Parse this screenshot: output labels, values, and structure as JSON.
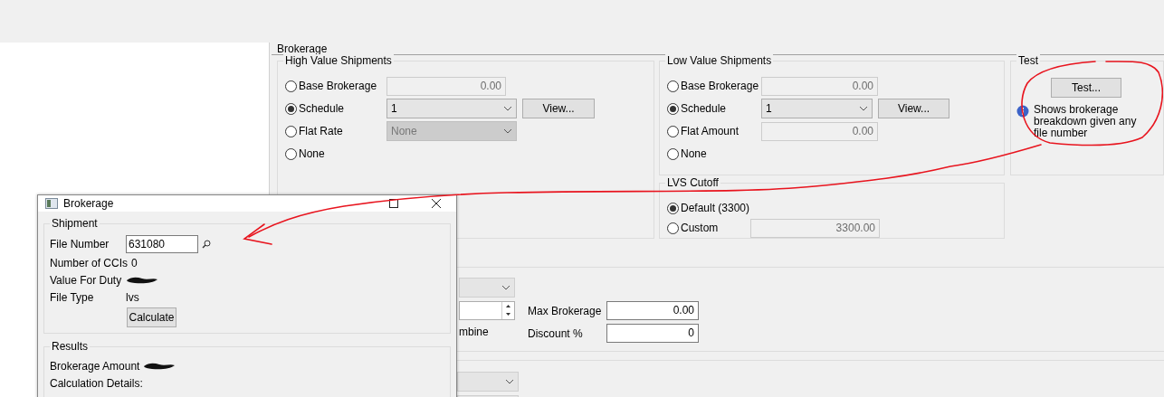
{
  "section_title": "Brokerage",
  "high_value": {
    "title": "High Value Shipments",
    "options": [
      {
        "label": "Base Brokerage",
        "selected": false,
        "kind": "input",
        "value": "0.00"
      },
      {
        "label": "Schedule",
        "selected": true,
        "kind": "select",
        "value": "1",
        "button": "View..."
      },
      {
        "label": "Flat Rate",
        "selected": false,
        "kind": "select_disabled",
        "value": "None"
      },
      {
        "label": "None",
        "selected": false,
        "kind": "none"
      }
    ]
  },
  "low_value": {
    "title": "Low Value Shipments",
    "options": [
      {
        "label": "Base Brokerage",
        "selected": false,
        "kind": "input",
        "value": "0.00"
      },
      {
        "label": "Schedule",
        "selected": true,
        "kind": "select",
        "value": "1",
        "button": "View..."
      },
      {
        "label": "Flat Amount",
        "selected": false,
        "kind": "input",
        "value": "0.00"
      },
      {
        "label": "None",
        "selected": false,
        "kind": "none"
      }
    ]
  },
  "test": {
    "title": "Test",
    "button": "Test...",
    "info": "Shows brokerage breakdown given any file number"
  },
  "lvs_cutoff": {
    "title": "LVS Cutoff",
    "options": [
      {
        "label": "Default (3300)",
        "selected": true,
        "kind": "none"
      },
      {
        "label": "Custom",
        "selected": false,
        "kind": "input",
        "value": "3300.00"
      }
    ]
  },
  "lower": {
    "partial_label": "mbine",
    "fields": [
      {
        "label": "Max Brokerage",
        "value": "0.00"
      },
      {
        "label": "Discount %",
        "value": "0"
      }
    ]
  },
  "dialog": {
    "title": "Brokerage",
    "shipment": {
      "title": "Shipment",
      "file_number_label": "File Number",
      "file_number": "631080",
      "rows": [
        {
          "label": "Number of CCIs",
          "value": "0",
          "redacted": false
        },
        {
          "label": "Value For Duty",
          "redacted": true
        },
        {
          "label": "File Type",
          "value": "lvs",
          "redacted": false
        }
      ],
      "button": "Calculate"
    },
    "results": {
      "title": "Results",
      "rows": [
        {
          "label": "Brokerage Amount",
          "redacted": true
        },
        {
          "label": "Calculation Details:",
          "redacted": false
        }
      ]
    }
  }
}
